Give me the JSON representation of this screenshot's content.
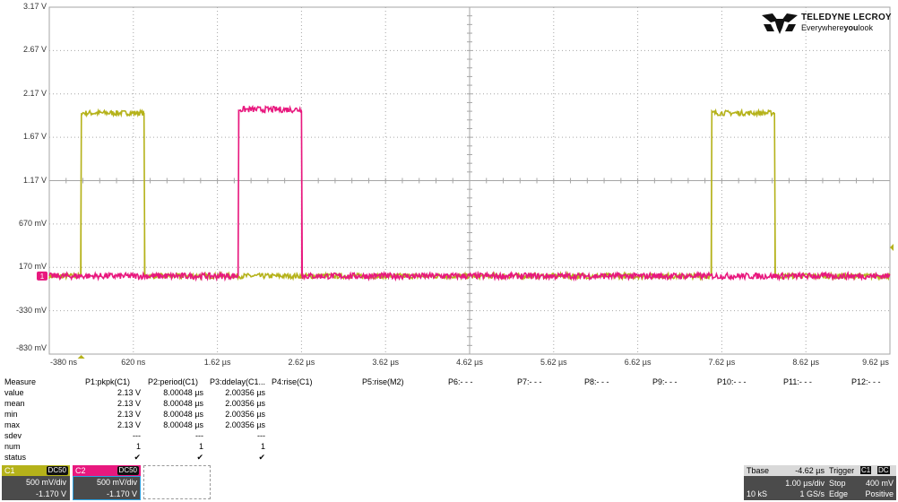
{
  "brand": {
    "name": "TELEDYNE LECROY",
    "tagline_pre": "Everywhere",
    "tagline_bold": "you",
    "tagline_post": "look"
  },
  "y_axis_labels": [
    "3.17 V",
    "2.67 V",
    "2.17 V",
    "1.67 V",
    "1.17 V",
    "670 mV",
    "170 mV",
    "-330 mV",
    "-830 mV"
  ],
  "x_axis_labels": [
    "-380 ns",
    "620 ns",
    "1.62 µs",
    "2.62 µs",
    "3.62 µs",
    "4.62 µs",
    "5.62 µs",
    "6.62 µs",
    "7.62 µs",
    "8.62 µs",
    "9.62 µs"
  ],
  "colors": {
    "c1": "#b5b21a",
    "c2": "#e8187e",
    "grid": "#a6a6a6",
    "panel": "#4b4b4b"
  },
  "waveforms": {
    "c1": {
      "low_V": 0.07,
      "high_V": 1.95,
      "pulses_us": [
        [
          0,
          0.75
        ],
        [
          7.5,
          8.25
        ]
      ]
    },
    "c2": {
      "low_V": 0.07,
      "high_V": 1.99,
      "pulses_us": [
        [
          1.87,
          2.62
        ]
      ]
    },
    "time_start_us": -0.38,
    "time_span_us": 10.0,
    "volt_top": 3.17,
    "volt_bottom": -0.83
  },
  "markers": {
    "ground_label": "1"
  },
  "measure": {
    "title": "Measure",
    "row_labels": [
      "value",
      "mean",
      "min",
      "max",
      "sdev",
      "num",
      "status"
    ],
    "params": [
      {
        "name": "P1:pkpk(C1)",
        "value": "2.13 V",
        "mean": "2.13 V",
        "min": "2.13 V",
        "max": "2.13 V",
        "sdev": "---",
        "num": "1",
        "status": "✔"
      },
      {
        "name": "P2:period(C1)",
        "value": "8.00048 µs",
        "mean": "8.00048 µs",
        "min": "8.00048 µs",
        "max": "8.00048 µs",
        "sdev": "---",
        "num": "1",
        "status": "✔"
      },
      {
        "name": "P3:ddelay(C1...",
        "value": "2.00356 µs",
        "mean": "2.00356 µs",
        "min": "2.00356 µs",
        "max": "2.00356 µs",
        "sdev": "---",
        "num": "1",
        "status": "✔"
      },
      {
        "name": "P4:rise(C1)"
      },
      {
        "name": "P5:rise(M2)"
      },
      {
        "name": "P6:- - -"
      },
      {
        "name": "P7:- - -"
      },
      {
        "name": "P8:- - -"
      },
      {
        "name": "P9:- - -"
      },
      {
        "name": "P10:- - -"
      },
      {
        "name": "P11:- - -"
      },
      {
        "name": "P12:- - -"
      }
    ]
  },
  "channels": [
    {
      "id": "C1",
      "coupling": "DC50",
      "vdiv": "500 mV/div",
      "offset": "-1.170 V",
      "color": "#b5b21a"
    },
    {
      "id": "C2",
      "coupling": "DC50",
      "vdiv": "500 mV/div",
      "offset": "-1.170 V",
      "color": "#e8187e"
    }
  ],
  "timebase": {
    "label": "Tbase",
    "delay": "-4.62 µs",
    "tdiv": "1.00 µs/div",
    "samples": "10 kS",
    "rate": "1 GS/s"
  },
  "trigger": {
    "label": "Trigger",
    "source": "C1",
    "coupling": "DC",
    "mode": "Stop",
    "level": "400 mV",
    "type": "Edge",
    "slope": "Positive"
  }
}
